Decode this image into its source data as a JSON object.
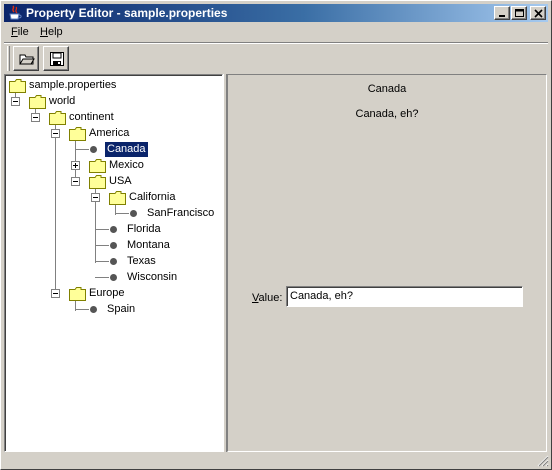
{
  "window": {
    "title": "Property Editor - sample.properties",
    "app_icon": "java-cup-icon",
    "controls": [
      "minimize-icon",
      "maximize-icon",
      "close-icon"
    ]
  },
  "menubar": {
    "file": {
      "mnemonic": "F",
      "rest": "ile"
    },
    "help": {
      "mnemonic": "H",
      "rest": "elp"
    }
  },
  "toolbar": {
    "buttons": [
      "open-folder-icon",
      "save-disk-icon"
    ]
  },
  "tree": {
    "root": "sample.properties",
    "world": "world",
    "continent": "continent",
    "america": "America",
    "canada": "Canada",
    "mexico": "Mexico",
    "usa": "USA",
    "california": "California",
    "sanfrancisco": "SanFrancisco",
    "florida": "Florida",
    "montana": "Montana",
    "texas": "Texas",
    "wisconsin": "Wisconsin",
    "europe": "Europe",
    "spain": "Spain",
    "selected": "Canada"
  },
  "detail": {
    "name": "Canada",
    "value_display": "Canada, eh?",
    "value_label": {
      "mnemonic": "V",
      "rest": "alue:"
    },
    "value_input": "Canada, eh?"
  },
  "colors": {
    "title_start": "#0a246a",
    "title_end": "#a6caf0",
    "selection": "#0a246a",
    "face": "#d4d0c8",
    "folder": "#ffff99"
  }
}
